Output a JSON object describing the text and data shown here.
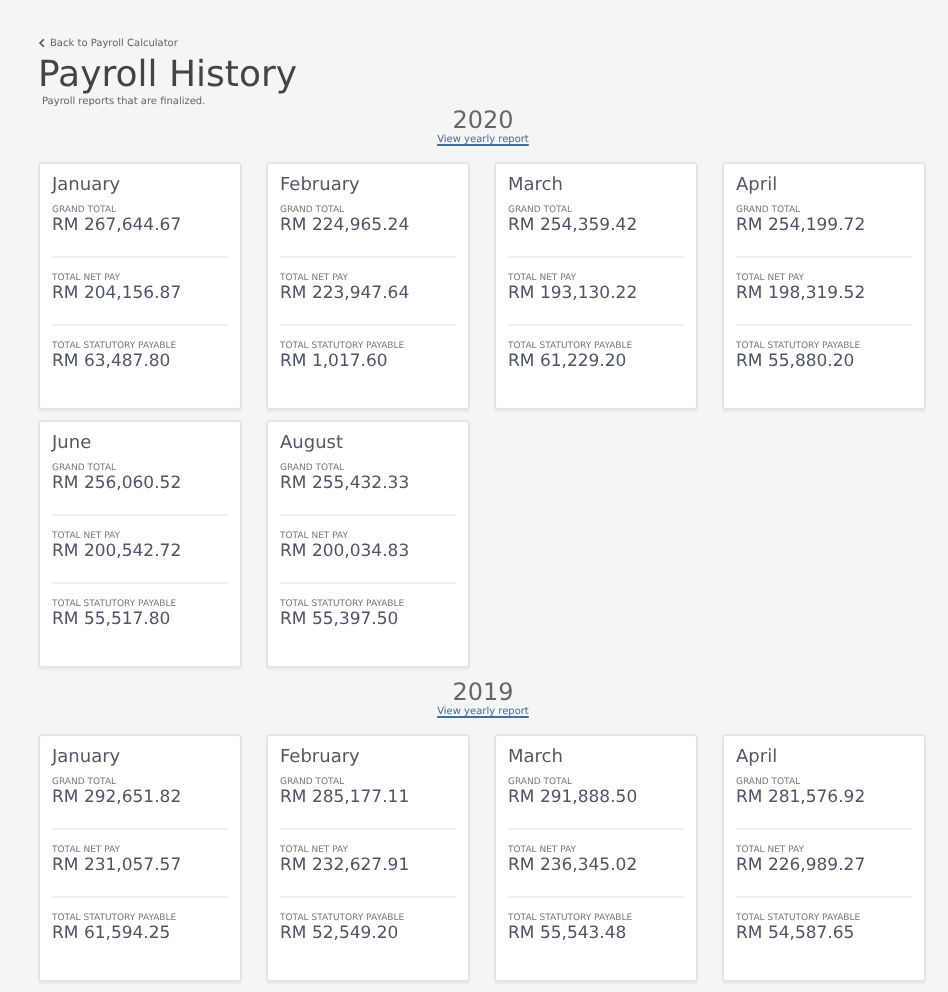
{
  "back_link": {
    "label": "Back to Payroll Calculator"
  },
  "title": "Payroll History",
  "subtitle": "Payroll reports that are finalized.",
  "years": [
    {
      "year": "2020",
      "link": "View yearly report",
      "months": [
        {
          "month": "January",
          "metrics": [
            {
              "label": "GRAND TOTAL",
              "value": "RM 267,644.67"
            },
            {
              "label": "TOTAL NET PAY",
              "value": "RM 204,156.87"
            },
            {
              "label": "TOTAL STATUTORY PAYABLE",
              "value": "RM 63,487.80"
            }
          ]
        },
        {
          "month": "February",
          "metrics": [
            {
              "label": "GRAND TOTAL",
              "value": "RM 224,965.24"
            },
            {
              "label": "TOTAL NET PAY",
              "value": "RM 223,947.64"
            },
            {
              "label": "TOTAL STATUTORY PAYABLE",
              "value": "RM 1,017.60"
            }
          ]
        },
        {
          "month": "March",
          "metrics": [
            {
              "label": "GRAND TOTAL",
              "value": "RM 254,359.42"
            },
            {
              "label": "TOTAL NET PAY",
              "value": "RM 193,130.22"
            },
            {
              "label": "TOTAL STATUTORY PAYABLE",
              "value": "RM 61,229.20"
            }
          ]
        },
        {
          "month": "April",
          "metrics": [
            {
              "label": "GRAND TOTAL",
              "value": "RM 254,199.72"
            },
            {
              "label": "TOTAL NET PAY",
              "value": "RM 198,319.52"
            },
            {
              "label": "TOTAL STATUTORY PAYABLE",
              "value": "RM 55,880.20"
            }
          ]
        },
        {
          "month": "June",
          "metrics": [
            {
              "label": "GRAND TOTAL",
              "value": "RM 256,060.52"
            },
            {
              "label": "TOTAL NET PAY",
              "value": "RM 200,542.72"
            },
            {
              "label": "TOTAL STATUTORY PAYABLE",
              "value": "RM 55,517.80"
            }
          ]
        },
        {
          "month": "August",
          "metrics": [
            {
              "label": "GRAND TOTAL",
              "value": "RM 255,432.33"
            },
            {
              "label": "TOTAL NET PAY",
              "value": "RM 200,034.83"
            },
            {
              "label": "TOTAL STATUTORY PAYABLE",
              "value": "RM 55,397.50"
            }
          ]
        }
      ]
    },
    {
      "year": "2019",
      "link": "View yearly report",
      "months": [
        {
          "month": "January",
          "metrics": [
            {
              "label": "GRAND TOTAL",
              "value": "RM 292,651.82"
            },
            {
              "label": "TOTAL NET PAY",
              "value": "RM 231,057.57"
            },
            {
              "label": "TOTAL STATUTORY PAYABLE",
              "value": "RM 61,594.25"
            }
          ]
        },
        {
          "month": "February",
          "metrics": [
            {
              "label": "GRAND TOTAL",
              "value": "RM 285,177.11"
            },
            {
              "label": "TOTAL NET PAY",
              "value": "RM 232,627.91"
            },
            {
              "label": "TOTAL STATUTORY PAYABLE",
              "value": "RM 52,549.20"
            }
          ]
        },
        {
          "month": "March",
          "metrics": [
            {
              "label": "GRAND TOTAL",
              "value": "RM 291,888.50"
            },
            {
              "label": "TOTAL NET PAY",
              "value": "RM 236,345.02"
            },
            {
              "label": "TOTAL STATUTORY PAYABLE",
              "value": "RM 55,543.48"
            }
          ]
        },
        {
          "month": "April",
          "metrics": [
            {
              "label": "GRAND TOTAL",
              "value": "RM 281,576.92"
            },
            {
              "label": "TOTAL NET PAY",
              "value": "RM 226,989.27"
            },
            {
              "label": "TOTAL STATUTORY PAYABLE",
              "value": "RM 54,587.65"
            }
          ]
        }
      ]
    }
  ]
}
